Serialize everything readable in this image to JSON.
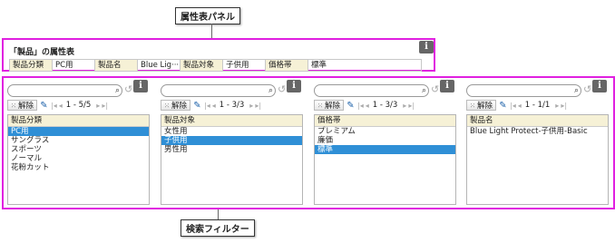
{
  "callouts": {
    "attribute_panel": "属性表パネル",
    "search_filter": "検索フィルター"
  },
  "attribute_panel": {
    "title": "「製品」の属性表",
    "info_label": "i",
    "cells": [
      {
        "text": "製品分類",
        "key": true
      },
      {
        "text": "PC用",
        "key": false
      },
      {
        "text": "製品名",
        "key": true
      },
      {
        "text": "Blue Lig···",
        "key": false
      },
      {
        "text": "製品対象",
        "key": true
      },
      {
        "text": "子供用",
        "key": false
      },
      {
        "text": "価格帯",
        "key": true
      },
      {
        "text": "標準",
        "key": false
      }
    ]
  },
  "filters": [
    {
      "clear_label": "解除",
      "page": "1 - 5/5",
      "info_label": "i",
      "header": "製品分類",
      "items": [
        "PC用",
        "サングラス",
        "スポーツ",
        "ノーマル",
        "花粉カット"
      ],
      "selected": [
        0
      ]
    },
    {
      "clear_label": "解除",
      "page": "1 - 3/3",
      "info_label": "i",
      "header": "製品対象",
      "items": [
        "女性用",
        "子供用",
        "男性用"
      ],
      "selected": [
        1
      ]
    },
    {
      "clear_label": "解除",
      "page": "1 - 3/3",
      "info_label": "i",
      "header": "価格帯",
      "items": [
        "プレミアム",
        "廉価",
        "標準"
      ],
      "selected": [
        2
      ]
    },
    {
      "clear_label": "解除",
      "page": "1 - 1/1",
      "info_label": "i",
      "header": "製品名",
      "items": [
        "Blue Light Protect-子供用-Basic"
      ],
      "selected": []
    }
  ],
  "colors": {
    "highlight_border": "#e020e0",
    "selection": "#2f8fd6",
    "header_bg": "#f6f1d6"
  }
}
